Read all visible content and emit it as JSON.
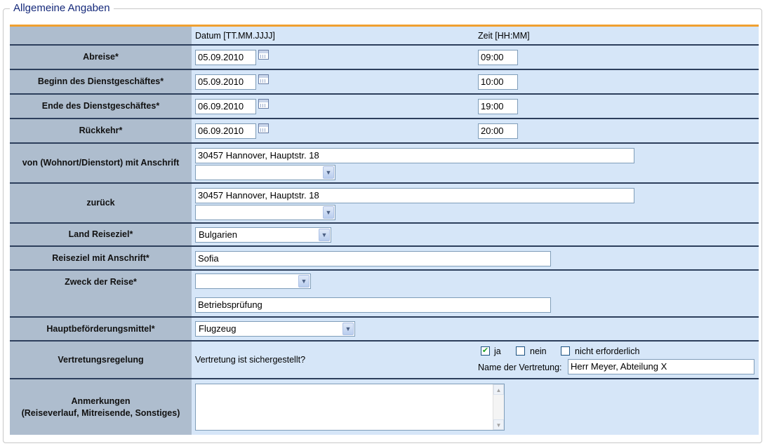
{
  "section": {
    "title": "Allgemeine Angaben"
  },
  "columns": {
    "date": "Datum [TT.MM.JJJJ]",
    "time": "Zeit [HH:MM]"
  },
  "rows": {
    "abreise": {
      "label": "Abreise*",
      "date": "05.09.2010",
      "time": "09:00"
    },
    "beginn": {
      "label": "Beginn des Dienstgeschäftes*",
      "date": "05.09.2010",
      "time": "10:00"
    },
    "ende": {
      "label": "Ende des Dienstgeschäftes*",
      "date": "06.09.2010",
      "time": "19:00"
    },
    "rueckkehr": {
      "label": "Rückkehr*",
      "date": "06.09.2010",
      "time": "20:00"
    },
    "von": {
      "label": "von (Wohnort/Dienstort) mit Anschrift",
      "address": "30457 Hannover, Hauptstr. 18",
      "select": ""
    },
    "zurueck": {
      "label": "zurück",
      "address": "30457 Hannover, Hauptstr. 18",
      "select": ""
    },
    "land": {
      "label": "Land Reiseziel*",
      "select": "Bulgarien"
    },
    "reiseziel": {
      "label": "Reiseziel mit Anschrift*",
      "value": "Sofia"
    },
    "zweck": {
      "label": "Zweck der Reise*",
      "select": "",
      "value": "Betriebsprüfung"
    },
    "befoerderung": {
      "label": "Hauptbeförderungsmittel*",
      "select": "Flugzeug"
    },
    "vertretung": {
      "label": "Vertretungsregelung",
      "question": "Vertretung ist sichergestellt?",
      "options": [
        {
          "label": "ja",
          "checked": true
        },
        {
          "label": "nein",
          "checked": false
        },
        {
          "label": "nicht erforderlich",
          "checked": false
        }
      ],
      "name_label": "Name der Vertretung:",
      "name_value": "Herr Meyer, Abteilung X"
    },
    "anmerkungen": {
      "label_line1": "Anmerkungen",
      "label_line2": "(Reiseverlauf, Mitreisende, Sonstiges)",
      "value": ""
    }
  },
  "icons": {
    "calendar": "calendar-icon",
    "dropdown": "chevron-down-icon",
    "check": "checkmark-icon"
  },
  "colors": {
    "label_bg": "#aebdce",
    "value_bg": "#d6e6f8",
    "row_border": "#2d3f5c",
    "accent": "#f0a030",
    "title": "#15297a"
  }
}
